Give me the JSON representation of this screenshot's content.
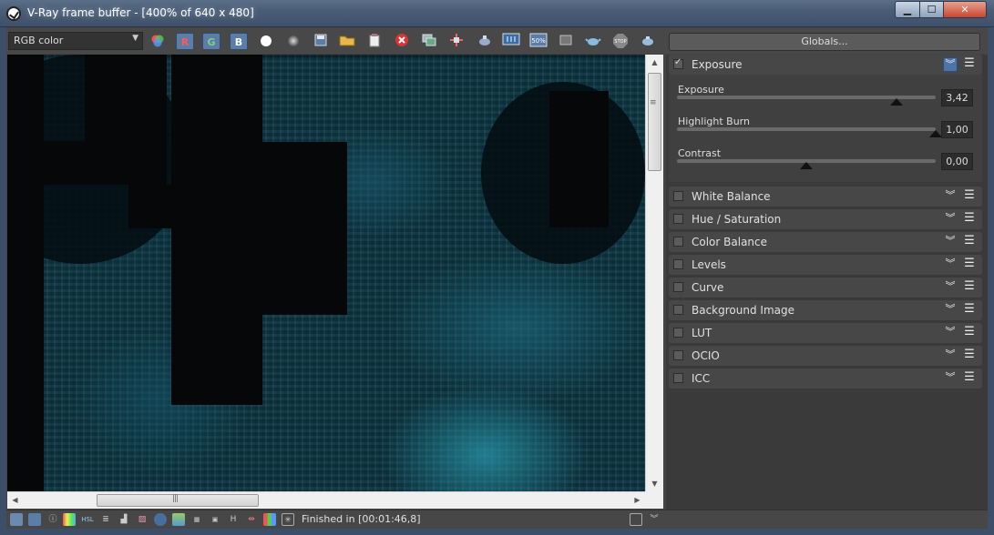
{
  "window": {
    "title": "V-Ray frame buffer - [400% of 640 x 480]",
    "minimize_label": "▁",
    "maximize_label": "☐",
    "close_label": "✕"
  },
  "toolbar": {
    "channel": "RGB color",
    "r_label": "R",
    "g_label": "G",
    "b_label": "B",
    "globals_label": "Globals..."
  },
  "panel": {
    "exposure": {
      "title": "Exposure",
      "enabled": true,
      "params": [
        {
          "label": "Exposure",
          "value": "3,42",
          "fraction": 0.85
        },
        {
          "label": "Highlight Burn",
          "value": "1,00",
          "fraction": 1.0
        },
        {
          "label": "Contrast",
          "value": "0,00",
          "fraction": 0.5
        }
      ]
    },
    "sections": [
      {
        "label": "White Balance"
      },
      {
        "label": "Hue / Saturation"
      },
      {
        "label": "Color Balance"
      },
      {
        "label": "Levels"
      },
      {
        "label": "Curve"
      },
      {
        "label": "Background Image"
      },
      {
        "label": "LUT"
      },
      {
        "label": "OCIO"
      },
      {
        "label": "ICC"
      }
    ]
  },
  "status": {
    "text": "Finished in [00:01:46,8]"
  },
  "colors": {
    "accent": "#4d74a8",
    "render_tint": "#0f3b48"
  }
}
